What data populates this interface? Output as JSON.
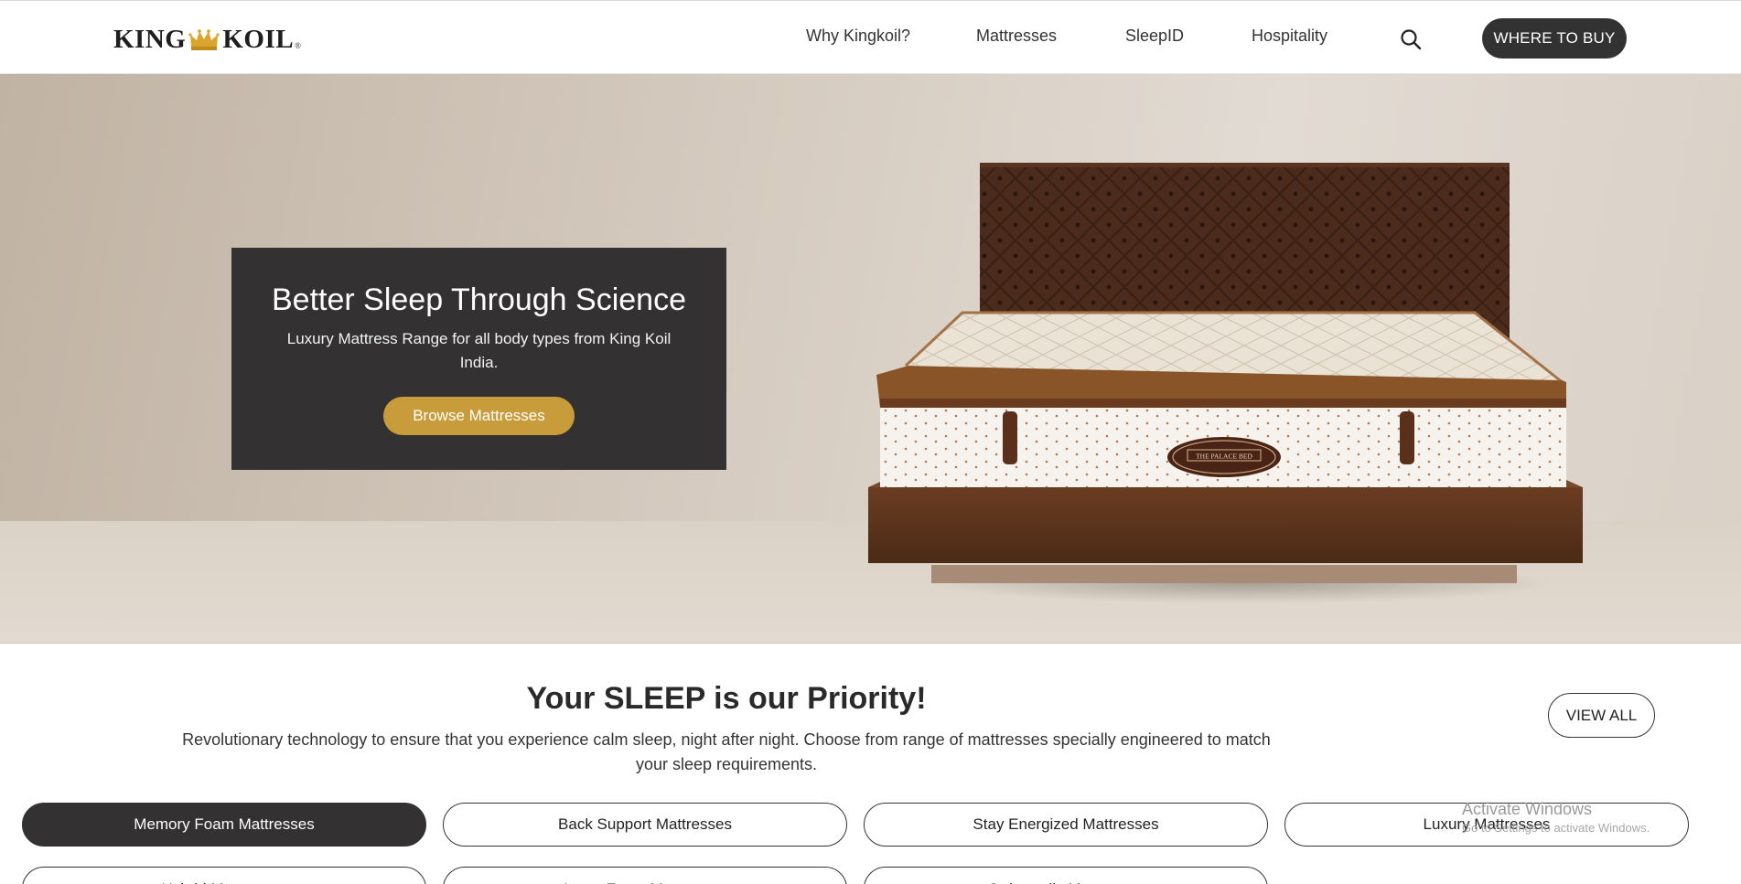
{
  "header": {
    "logo": {
      "left": "KING",
      "right": "KOIL",
      "reg": "®"
    },
    "nav": [
      "Why Kingkoil?",
      "Mattresses",
      "SleepID",
      "Hospitality"
    ],
    "search_icon": "search-icon",
    "buy_label": "WHERE TO BUY"
  },
  "hero": {
    "title": "Better Sleep Through Science",
    "subtitle": "Luxury Mattress Range for all body types from King Koil India.",
    "cta": "Browse Mattresses",
    "bed_label": "THE PALACE BED"
  },
  "section": {
    "title": "Your SLEEP is our Priority!",
    "description": "Revolutionary technology to ensure that you experience calm sleep, night after night. Choose from range of mattresses specially engineered to match your sleep requirements.",
    "view_all": "VIEW ALL"
  },
  "categories": [
    {
      "label": "Memory Foam Mattresses",
      "active": true
    },
    {
      "label": "Back Support Mattresses",
      "active": false
    },
    {
      "label": "Stay Energized Mattresses",
      "active": false
    },
    {
      "label": "Luxury Mattresses",
      "active": false
    },
    {
      "label": "Hybrid Mattresses",
      "active": false
    },
    {
      "label": "Latex Foam Mattresses",
      "active": false
    },
    {
      "label": "Orthopedic Mattresses",
      "active": false
    }
  ],
  "watermark": {
    "title": "Activate Windows",
    "sub": "Go to Settings to activate Windows."
  },
  "colors": {
    "dark": "#333132",
    "gold": "#c89c3a",
    "hero_bg": "#d2c7bb",
    "headboard": "#4a2b1c"
  }
}
